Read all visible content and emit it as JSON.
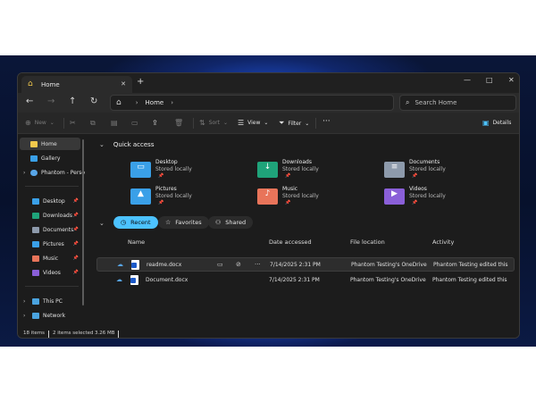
{
  "window": {
    "tab_title": "Home",
    "tab_close": "✕",
    "new_tab": "+",
    "controls": {
      "minimize": "—",
      "maximize": "□",
      "close": "✕"
    }
  },
  "nav": {
    "back": "←",
    "forward": "→",
    "up": "↑",
    "refresh": "↻"
  },
  "address": {
    "home_glyph": "⌂",
    "crumb": "Home",
    "chevron": "›"
  },
  "search": {
    "placeholder": "Search Home",
    "icon": "search-icon"
  },
  "toolbar": {
    "new_label": "New",
    "sort_label": "Sort",
    "view_label": "View",
    "filter_label": "Filter",
    "more_label": "···",
    "details_label": "Details"
  },
  "sidebar": {
    "home": "Home",
    "gallery": "Gallery",
    "onedrive": "Phantom - Perso",
    "desktop": "Desktop",
    "downloads": "Downloads",
    "documents": "Documents",
    "pictures": "Pictures",
    "music": "Music",
    "videos": "Videos",
    "thispc": "This PC",
    "network": "Network"
  },
  "quick_access": {
    "title": "Quick access",
    "items": [
      {
        "name": "Desktop",
        "status": "Stored locally",
        "color": "#3aa0e8"
      },
      {
        "name": "Downloads",
        "status": "Stored locally",
        "color": "#1fa37a"
      },
      {
        "name": "Documents",
        "status": "Stored locally",
        "color": "#8d9aab"
      },
      {
        "name": "Pictures",
        "status": "Stored locally",
        "color": "#3aa0e8"
      },
      {
        "name": "Music",
        "status": "Stored locally",
        "color": "#e8745a"
      },
      {
        "name": "Videos",
        "status": "Stored locally",
        "color": "#8a5fd8"
      }
    ]
  },
  "tabs": {
    "recent": "Recent",
    "favorites": "Favorites",
    "shared": "Shared"
  },
  "columns": {
    "name": "Name",
    "date": "Date accessed",
    "location": "File location",
    "activity": "Activity"
  },
  "files": [
    {
      "name": "readme.docx",
      "date": "7/14/2025 2:31 PM",
      "location": "Phantom Testing's OneDrive",
      "activity": "Phantom Testing edited this"
    },
    {
      "name": "Document.docx",
      "date": "7/14/2025 2:31 PM",
      "location": "Phantom Testing's OneDrive",
      "activity": "Phantom Testing edited this"
    }
  ],
  "status": {
    "items": "18 items",
    "selected": "2 items selected",
    "size": "3.26 MB"
  },
  "colors": {
    "accent": "#4cc2ff",
    "window_bg": "#1c1c1c"
  }
}
